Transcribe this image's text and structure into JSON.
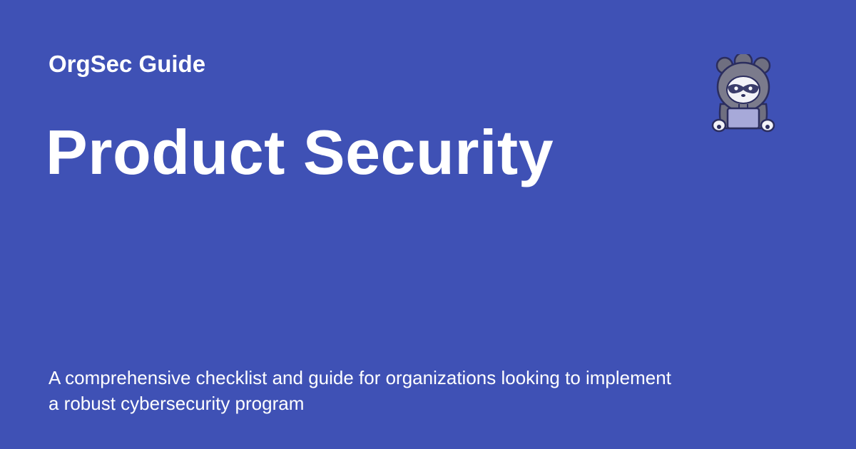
{
  "site": {
    "name": "OrgSec Guide"
  },
  "page": {
    "title": "Product Security",
    "description": "A comprehensive checklist and guide for organizations looking to implement a robust cybersecurity program"
  },
  "colors": {
    "background": "#3f51b5",
    "text": "#ffffff"
  },
  "mascot": {
    "icon": "raccoon-hacker-with-laptop"
  }
}
